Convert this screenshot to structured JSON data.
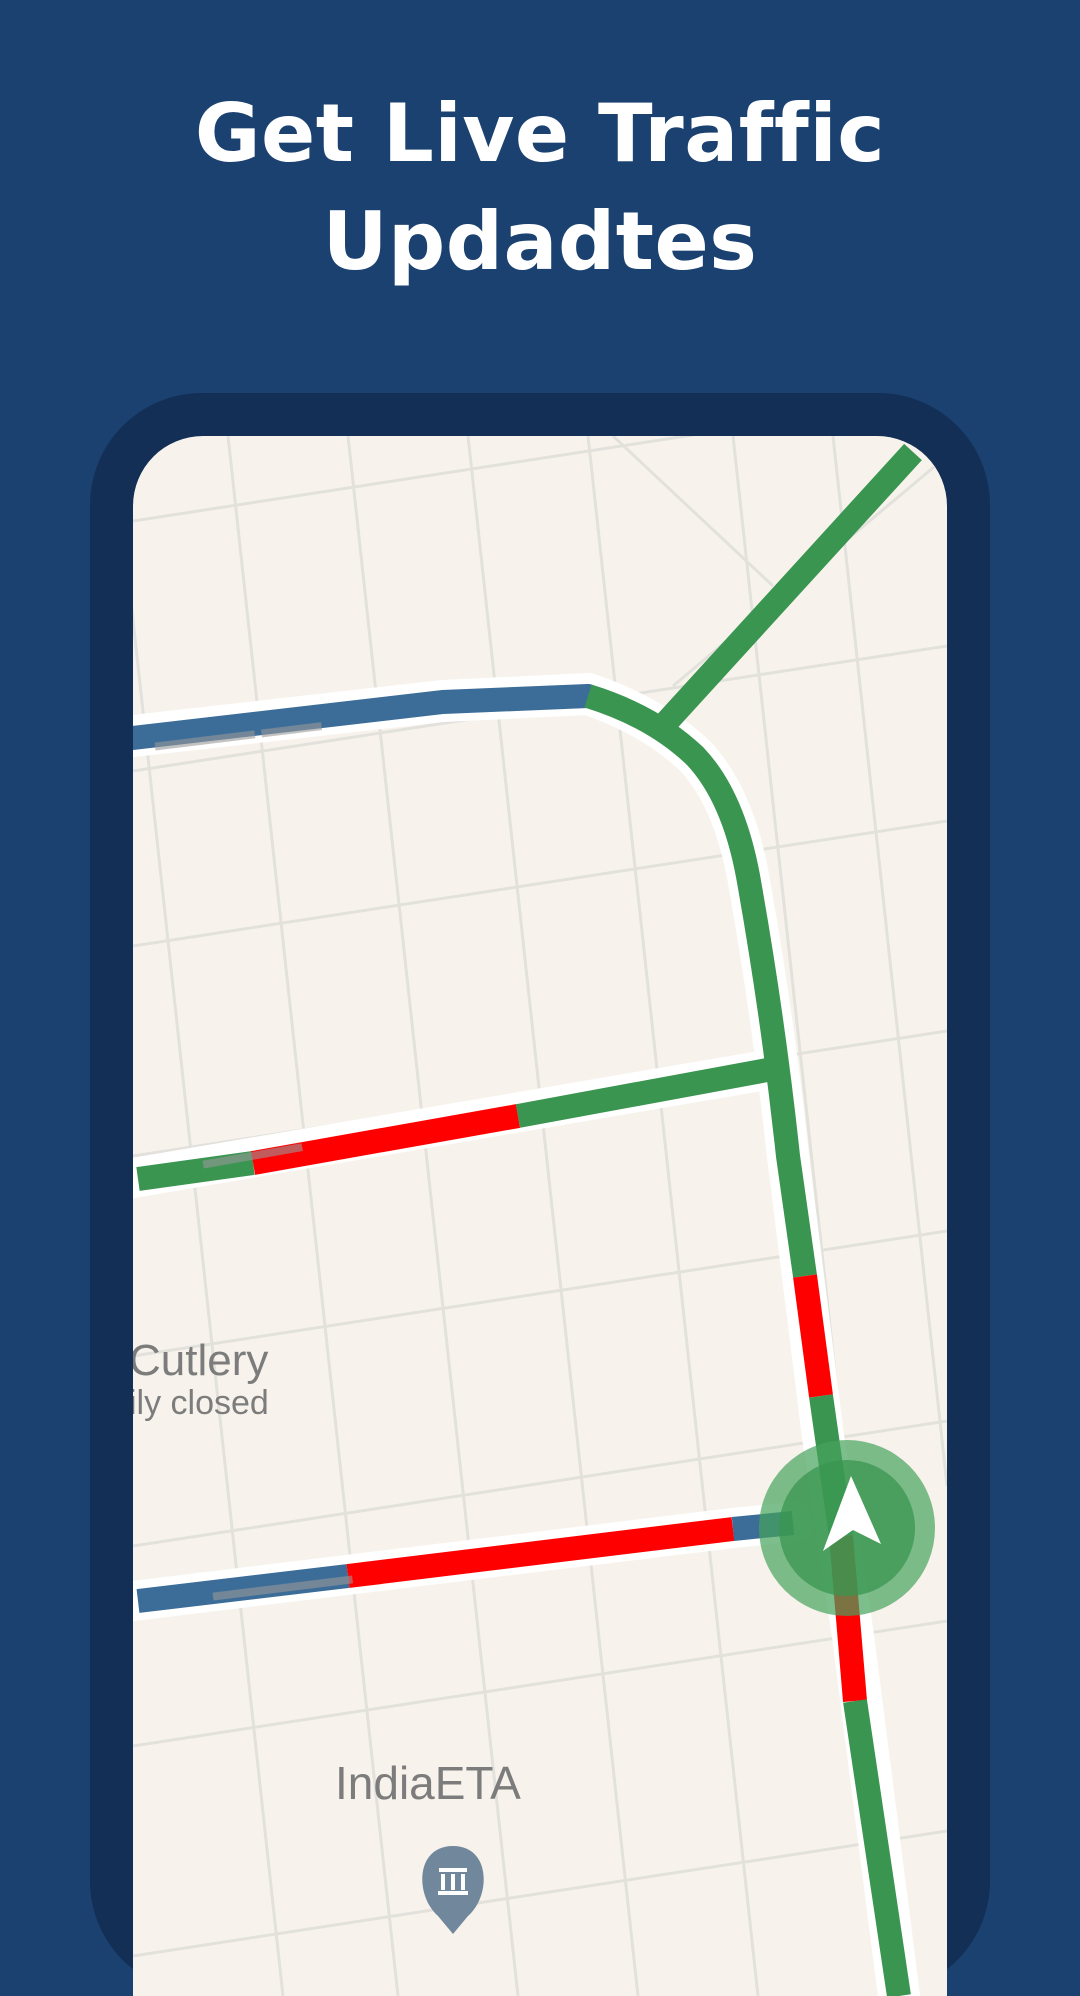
{
  "header": {
    "title_line1": "Get Live Traffic",
    "title_line2": "Updadtes"
  },
  "map": {
    "place_label_name": "Cutlery",
    "place_label_status": "ily closed",
    "landmark_label": "IndiaETA",
    "landmark_icon": "museum-pin-icon",
    "location_icon": "navigation-arrow-icon",
    "colors": {
      "background": "#1a4170",
      "frame": "#142f56",
      "map_bg": "#f7f3ec",
      "traffic_clear": "#3a9550",
      "traffic_heavy": "#ff0000",
      "traffic_slow": "#3b6d98",
      "location_halo": "#46a35c"
    }
  }
}
